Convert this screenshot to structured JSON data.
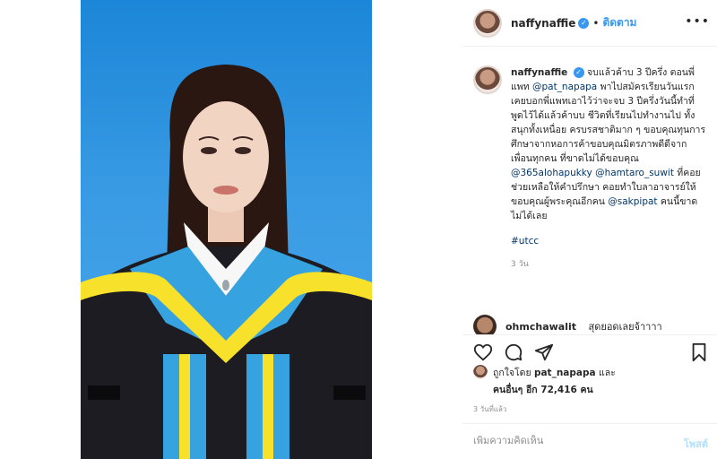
{
  "post": {
    "username": "naffynaffie",
    "follow_label": "ติดตาม",
    "more_label": "•••"
  },
  "caption": {
    "username": "naffynaffie",
    "line_a": "จบแล้วค้าบ 3 ปีครึ่ง ตอนพี่แพท",
    "mention1": "@pat_napapa",
    "line_b": " พาไปสมัครเรียนวันแรกเคยบอกพี่แพทเอาไว้ว่าจะจบ 3 ปีครึ่งวันนี้ทำที่พูดไว้ได้แล้วค้าบบ ชีวิตที่เรียนไปทำงานไป ทั้งสนุกทั้งเหนื่อย ครบรสชาติมาก ๆ ขอบคุณทุนการศึกษาจากหอการค้าขอบคุณมิตรภาพดีดีจากเพื่อนทุกคน ที่ขาดไม่ได้ขอบคุณ ",
    "mention2": "@365alohapukky",
    "mention3": "@hamtaro_suwit",
    "line_c": " ที่คอยช่วยเหลือให้คำปรึกษา คอยทำใบลาอาจารย์ให้ ขอบคุณผู้พระคุณอีกคน ",
    "mention4": "@sakpipat",
    "line_d": " คนนี้ขาดไม่ได้เลย",
    "hashtag": "#utcc",
    "time": "3 วัน"
  },
  "comment2": {
    "username": "ohmchawalit",
    "text": "สุดยอดเลยจ้าาาา"
  },
  "icons": [
    "heart-icon",
    "comment-icon",
    "share-icon",
    "bookmark-icon"
  ],
  "likes": {
    "prefix": "ถูกใจโดย",
    "user": "pat_napapa",
    "suffix": "และ",
    "others": "คนอื่นๆ อีก 72,416 คน"
  },
  "date": "3 วันที่แล้ว",
  "add_comment": {
    "placeholder": "เพิ่มความคิดเห็น",
    "post_label": "โพสต์"
  },
  "colors": {
    "accent": "#3897f0",
    "link": "#00376b",
    "photo_bg": "#2f95e0",
    "gown_blue": "#36a3e0",
    "gown_yellow": "#f7e12a"
  }
}
